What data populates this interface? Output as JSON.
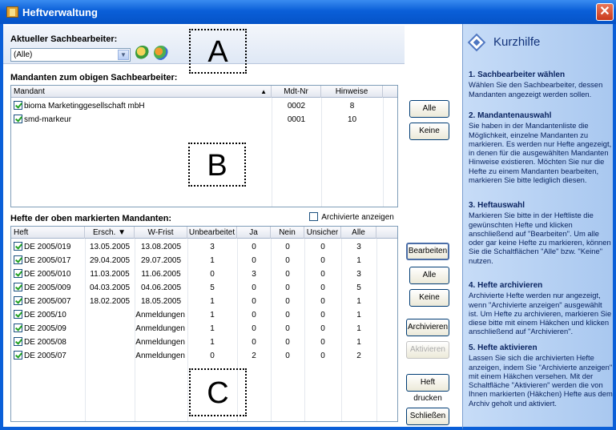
{
  "window": {
    "title": "Heftverwaltung",
    "close": "✕"
  },
  "top": {
    "label": "Aktueller Sachbearbeiter:",
    "select_value": "(Alle)",
    "marker": "A"
  },
  "mandanten": {
    "label": "Mandanten zum obigen Sachbearbeiter:",
    "columns": [
      "Mandant",
      "Mdt-Nr",
      "Hinweise"
    ],
    "sort_arrow": "▲",
    "rows": [
      {
        "name": "bioma Marketinggesellschaft mbH",
        "nr": "0002",
        "hinweise": "8"
      },
      {
        "name": "smd-markeur",
        "nr": "0001",
        "hinweise": "10"
      }
    ],
    "btn_all": "Alle",
    "btn_none": "Keine",
    "marker": "B"
  },
  "hefte": {
    "label": "Hefte der oben markierten Mandanten:",
    "archived_label": "Archivierte anzeigen",
    "columns": [
      "Heft",
      "Ersch. ▼",
      "W-Frist",
      "Unbearbeitet",
      "Ja",
      "Nein",
      "Unsicher",
      "Alle"
    ],
    "rows": [
      [
        "DE 2005/019",
        "13.05.2005",
        "13.08.2005",
        "3",
        "0",
        "0",
        "0",
        "3"
      ],
      [
        "DE 2005/017",
        "29.04.2005",
        "29.07.2005",
        "1",
        "0",
        "0",
        "0",
        "1"
      ],
      [
        "DE 2005/010",
        "11.03.2005",
        "11.06.2005",
        "0",
        "3",
        "0",
        "0",
        "3"
      ],
      [
        "DE 2005/009",
        "04.03.2005",
        "04.06.2005",
        "5",
        "0",
        "0",
        "0",
        "5"
      ],
      [
        "DE 2005/007",
        "18.02.2005",
        "18.05.2005",
        "1",
        "0",
        "0",
        "0",
        "1"
      ],
      [
        "DE 2005/10",
        "",
        "Anmeldungen",
        "1",
        "0",
        "0",
        "0",
        "1"
      ],
      [
        "DE 2005/09",
        "",
        "Anmeldungen",
        "1",
        "0",
        "0",
        "0",
        "1"
      ],
      [
        "DE 2005/08",
        "",
        "Anmeldungen",
        "1",
        "0",
        "0",
        "0",
        "1"
      ],
      [
        "DE 2005/07",
        "",
        "Anmeldungen",
        "0",
        "2",
        "0",
        "0",
        "2"
      ]
    ],
    "marker": "C"
  },
  "buttons": {
    "bearbeiten": "Bearbeiten",
    "alle": "Alle",
    "keine": "Keine",
    "archivieren": "Archivieren",
    "aktivieren": "Aktivieren",
    "drucken": "Heft drucken",
    "schliessen": "Schließen"
  },
  "help": {
    "title": "Kurzhilfe",
    "sections": [
      {
        "title": "1. Sachbearbeiter wählen",
        "text": "Wählen Sie den Sachbearbeiter, dessen Mandanten angezeigt werden sollen."
      },
      {
        "title": "2. Mandantenauswahl",
        "text": "Sie haben in der Mandantenliste die Möglichkeit, einzelne Mandanten zu markieren. Es werden nur Hefte angezeigt, in denen für die ausgewählten Mandanten Hinweise existieren. Möchten Sie nur die Hefte zu einem Mandanten bearbeiten, markieren Sie bitte lediglich diesen."
      },
      {
        "title": "3. Heftauswahl",
        "text": "Markieren Sie bitte in der Heftliste die gewünschten Hefte und klicken anschließend auf \"Bearbeiten\". Um alle oder gar keine Hefte zu markieren, können Sie die Schaltflächen \"Alle\" bzw. \"Keine\" nutzen."
      },
      {
        "title": "4. Hefte archivieren",
        "text": "Archivierte Hefte werden nur angezeigt, wenn \"Archivierte anzeigen\" ausgewählt ist. Um Hefte zu archivieren, markieren Sie diese bitte mit einem Häkchen und klicken anschließend auf \"Archivieren\"."
      },
      {
        "title": "5. Hefte aktivieren",
        "text": "Lassen Sie sich die archivierten Hefte anzeigen, indem Sie \"Archivierte anzeigen\" mit einem Häkchen versehen. Mit der Schaltfläche \"Aktivieren\" werden die von Ihnen markierten (Häkchen) Hefte aus dem Archiv geholt und aktiviert."
      }
    ]
  }
}
